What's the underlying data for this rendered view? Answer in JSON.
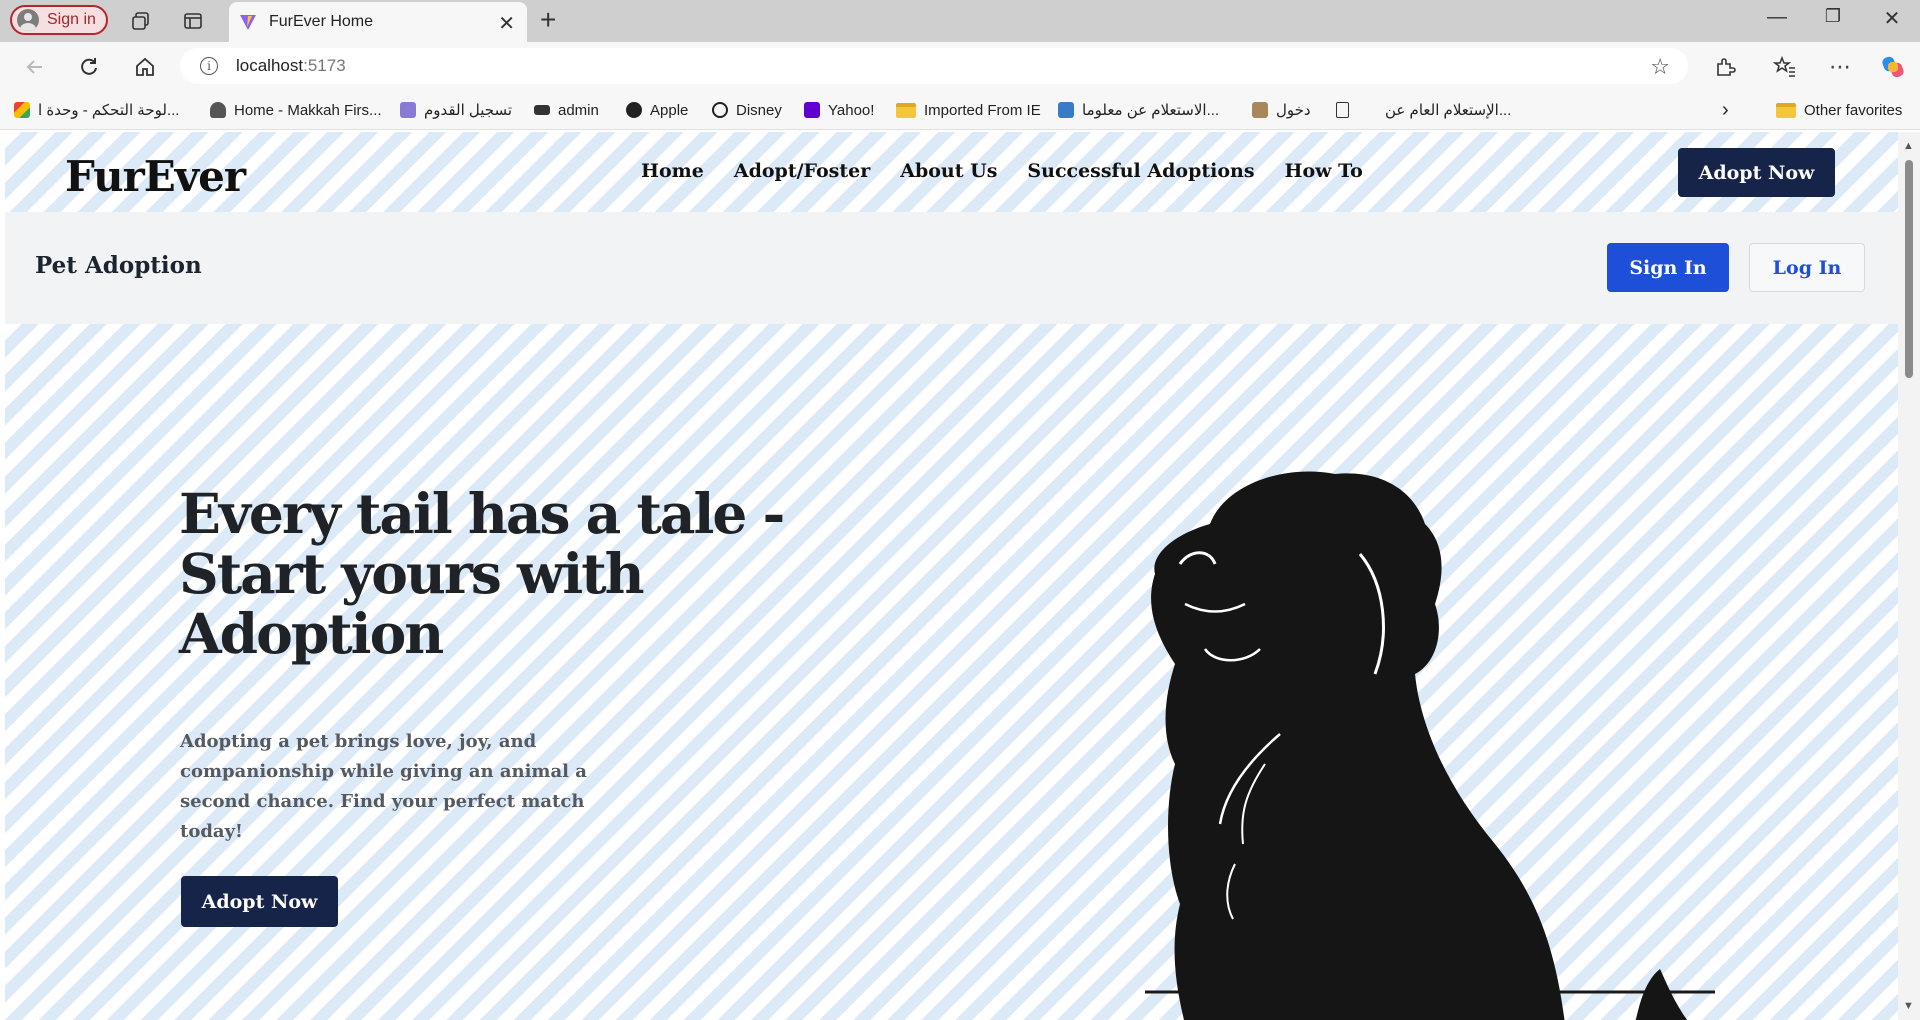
{
  "browser": {
    "signin_label": "Sign in",
    "tab_title": "FurEver Home",
    "url_host": "localhost",
    "url_port": ":5173",
    "bookmarks": [
      {
        "label": "لوحة التحكم - وحدة ا...",
        "icon": "gmail-icon"
      },
      {
        "label": "Home - Makkah Firs...",
        "icon": "bird-icon"
      },
      {
        "label": "تسجيل القدوم",
        "icon": "puzzle-icon"
      },
      {
        "label": "admin",
        "icon": "graduation-cap-icon"
      },
      {
        "label": "Apple",
        "icon": "apple-icon"
      },
      {
        "label": "Disney",
        "icon": "disney-icon"
      },
      {
        "label": "Yahoo!",
        "icon": "yahoo-icon"
      },
      {
        "label": "Imported From IE",
        "icon": "folder-icon"
      },
      {
        "label": "الاستعلام عن معلوما...",
        "icon": "site-icon"
      },
      {
        "label": "دخول",
        "icon": "image-icon"
      },
      {
        "label": "الإستعلام العام عن...",
        "icon": "document-icon"
      }
    ],
    "other_favorites": "Other favorites"
  },
  "site": {
    "brand": "FurEver",
    "nav": [
      "Home",
      "Adopt/Foster",
      "About Us",
      "Successful Adoptions",
      "How To"
    ],
    "nav_cta": "Adopt Now",
    "sub_title": "Pet Adoption",
    "signin": "Sign In",
    "login": "Log In",
    "hero_title": "Every tail has a tale - Start yours with Adoption",
    "hero_text": "Adopting a pet brings love, joy, and companionship while giving an animal a second chance. Find your perfect match today!",
    "hero_cta": "Adopt Now"
  },
  "colors": {
    "navy": "#172449",
    "blue": "#1d4fd8",
    "pattern": "#dce9f6"
  }
}
